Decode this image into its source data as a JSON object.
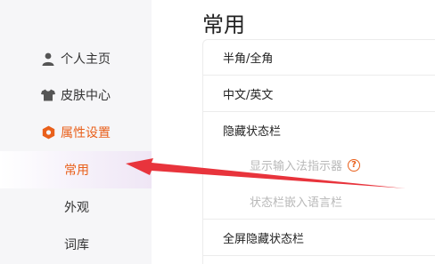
{
  "sidebar": {
    "items": [
      {
        "label": "个人主页",
        "icon": "user-icon"
      },
      {
        "label": "皮肤中心",
        "icon": "shirt-icon"
      },
      {
        "label": "属性设置",
        "icon": "hexagon-settings-icon"
      }
    ],
    "sub_items": [
      {
        "label": "常用"
      },
      {
        "label": "外观"
      },
      {
        "label": "词库"
      }
    ]
  },
  "main": {
    "title": "常用",
    "rows": [
      {
        "label": "半角/全角"
      },
      {
        "label": "中文/英文"
      },
      {
        "label": "隐藏状态栏"
      },
      {
        "label": "显示输入法指示器",
        "help": "?"
      },
      {
        "label": "状态栏嵌入语言栏"
      },
      {
        "label": "全屏隐藏状态栏"
      }
    ]
  },
  "colors": {
    "accent": "#e9601b",
    "arrow": "#e8343c",
    "sidebar_bg": "#f6f6f8",
    "disabled_text": "#b8b8b8"
  }
}
